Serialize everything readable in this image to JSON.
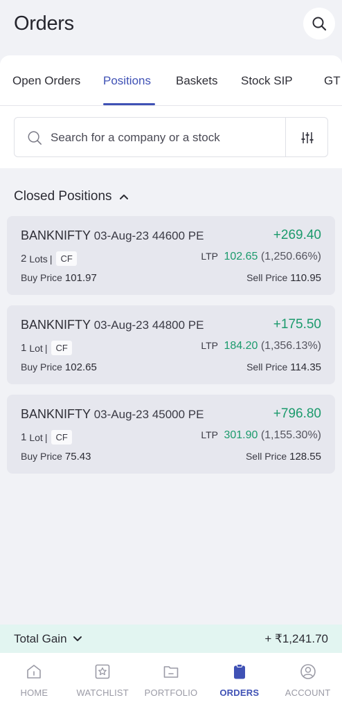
{
  "header": {
    "title": "Orders"
  },
  "tabs": [
    {
      "label": "Open Orders"
    },
    {
      "label": "Positions"
    },
    {
      "label": "Baskets"
    },
    {
      "label": "Stock SIP"
    },
    {
      "label": "GT"
    }
  ],
  "active_tab": "Positions",
  "search": {
    "placeholder": "Search for a company or a stock"
  },
  "section": {
    "title": "Closed Positions"
  },
  "positions": [
    {
      "symbol": "BANKNIFTY",
      "detail": "03-Aug-23 44600 PE",
      "pnl": "+269.40",
      "lots_count": "2",
      "lots_label": "Lots",
      "bar": "|",
      "tag": "CF",
      "ltp_label": "LTP",
      "ltp_value": "102.65",
      "ltp_change": "(1,250.66%)",
      "buy_label": "Buy Price",
      "buy_value": "101.97",
      "sell_label": "Sell Price",
      "sell_value": "110.95"
    },
    {
      "symbol": "BANKNIFTY",
      "detail": "03-Aug-23 44800 PE",
      "pnl": "+175.50",
      "lots_count": "1",
      "lots_label": "Lot",
      "bar": "|",
      "tag": "CF",
      "ltp_label": "LTP",
      "ltp_value": "184.20",
      "ltp_change": "(1,356.13%)",
      "buy_label": "Buy Price",
      "buy_value": "102.65",
      "sell_label": "Sell Price",
      "sell_value": "114.35"
    },
    {
      "symbol": "BANKNIFTY",
      "detail": "03-Aug-23 45000 PE",
      "pnl": "+796.80",
      "lots_count": "1",
      "lots_label": "Lot",
      "bar": "|",
      "tag": "CF",
      "ltp_label": "LTP",
      "ltp_value": "301.90",
      "ltp_change": "(1,155.30%)",
      "buy_label": "Buy Price",
      "buy_value": "75.43",
      "sell_label": "Sell Price",
      "sell_value": "128.55"
    }
  ],
  "total": {
    "label": "Total Gain",
    "amount": "+ ₹1,241.70"
  },
  "nav": [
    {
      "label": "HOME",
      "icon": "home-icon"
    },
    {
      "label": "WATCHLIST",
      "icon": "watchlist-icon"
    },
    {
      "label": "PORTFOLIO",
      "icon": "portfolio-icon"
    },
    {
      "label": "ORDERS",
      "icon": "orders-icon"
    },
    {
      "label": "ACCOUNT",
      "icon": "account-icon"
    }
  ],
  "active_nav": "ORDERS",
  "colors": {
    "accent": "#3f51b5",
    "gain": "#1b9a6c",
    "total_bar_bg": "#e2f5f1"
  }
}
